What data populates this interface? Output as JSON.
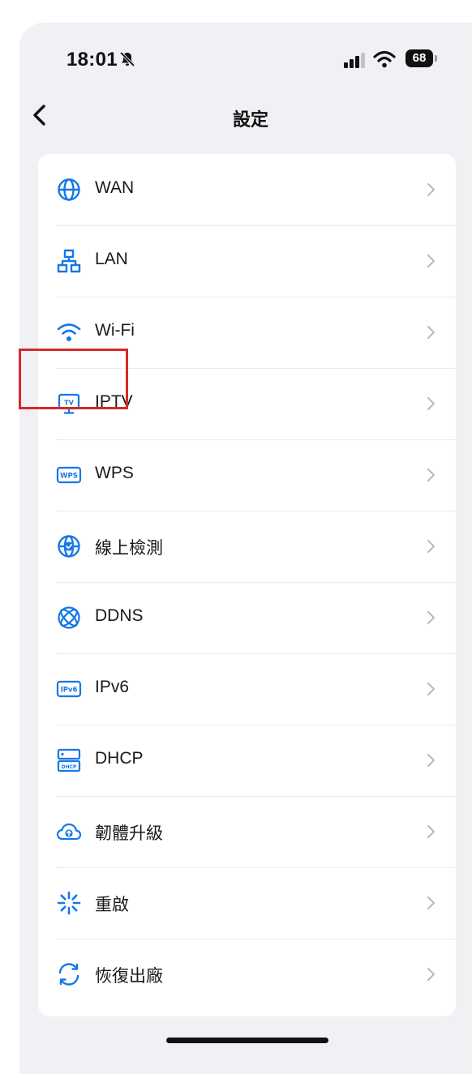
{
  "status_bar": {
    "time": "18:01",
    "battery": "68",
    "icons": [
      "bell-slash-icon",
      "signal-icon",
      "wifi-icon",
      "battery-icon"
    ]
  },
  "nav": {
    "title": "設定",
    "back_icon": "chevron-left-icon"
  },
  "colors": {
    "accent": "#1677e8",
    "background": "#f0f0f5",
    "card": "#ffffff",
    "highlight": "#d42a2a",
    "chevron": "#b8b8bd"
  },
  "settings": {
    "items": [
      {
        "label": "WAN",
        "icon": "globe-icon"
      },
      {
        "label": "LAN",
        "icon": "network-icon"
      },
      {
        "label": "Wi-Fi",
        "icon": "wifi-icon"
      },
      {
        "label": "IPTV",
        "icon": "tv-icon",
        "highlighted": true
      },
      {
        "label": "WPS",
        "icon": "wps-icon"
      },
      {
        "label": "線上檢測",
        "icon": "online-check-icon"
      },
      {
        "label": "DDNS",
        "icon": "ddns-icon"
      },
      {
        "label": "IPv6",
        "icon": "ipv6-icon"
      },
      {
        "label": "DHCP",
        "icon": "dhcp-icon"
      },
      {
        "label": "韌體升級",
        "icon": "cloud-upload-icon"
      },
      {
        "label": "重啟",
        "icon": "restart-icon"
      },
      {
        "label": "恢復出廠",
        "icon": "reset-icon"
      }
    ]
  }
}
